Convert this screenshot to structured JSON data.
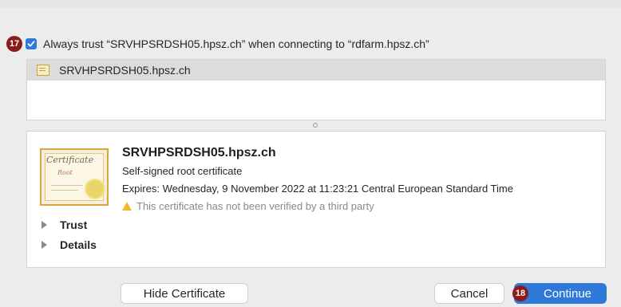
{
  "steps": {
    "trust_step": "17",
    "continue_step": "18"
  },
  "trust_checkbox": {
    "checked": true,
    "label": "Always trust “SRVHPSRDSH05.hpsz.ch” when connecting to “rdfarm.hpsz.ch”"
  },
  "cert_list": {
    "items": [
      {
        "label": "SRVHPSRDSH05.hpsz.ch",
        "selected": true
      }
    ]
  },
  "certificate": {
    "name": "SRVHPSRDSH05.hpsz.ch",
    "type": "Self-signed root certificate",
    "expiry": "Expires: Wednesday, 9 November 2022 at 11:23:21 Central European Standard Time",
    "warning": "This certificate has not been verified by a third party",
    "image_title": "Certificate",
    "image_subtitle": "Root"
  },
  "sections": [
    {
      "label": "Trust",
      "expanded": false
    },
    {
      "label": "Details",
      "expanded": false
    }
  ],
  "buttons": {
    "hide": "Hide Certificate",
    "cancel": "Cancel",
    "continue": "Continue"
  },
  "colors": {
    "accent": "#2f7ad8",
    "step_badge": "#8b1a1a",
    "warning": "#f5b82e"
  }
}
